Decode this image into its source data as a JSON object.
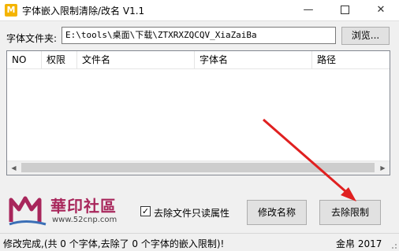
{
  "window": {
    "title": "字体嵌入限制清除/改名 V1.1",
    "icon": "font-app-icon",
    "minimize_glyph": "—",
    "close_glyph": "✕"
  },
  "folder": {
    "label": "字体文件夹:",
    "value": "E:\\tools\\桌面\\下载\\ZTXRXZQCQV_XiaZaiBa",
    "browse_label": "浏览..."
  },
  "list": {
    "columns": [
      "NO",
      "权限",
      "文件名",
      "字体名",
      "路径"
    ]
  },
  "logo": {
    "title": "華印社區",
    "url": "www.52cnp.com"
  },
  "options": {
    "readonly_label": "去除文件只读属性",
    "readonly_checked": true
  },
  "buttons": {
    "rename": "修改名称",
    "remove": "去除限制"
  },
  "status": {
    "message": "修改完成,(共 0 个字体,去除了 0 个字体的嵌入限制)!",
    "right": "金帛 2017"
  },
  "colors": {
    "annotation_arrow": "#e02020",
    "logo_brand": "#a8265b",
    "icon_bg": "#f4b400"
  }
}
